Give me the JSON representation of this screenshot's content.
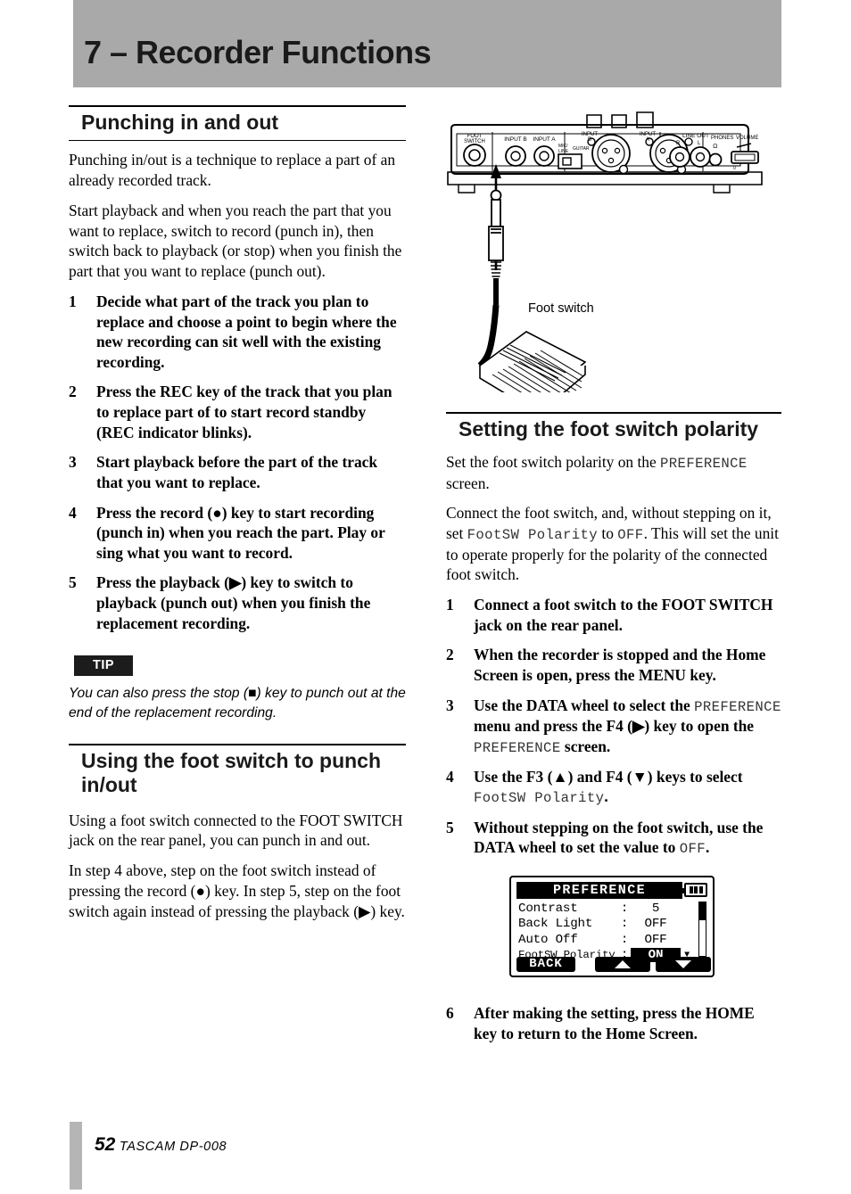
{
  "chapter": {
    "title": "7 – Recorder Functions",
    "bar_color": "#a9a9a9"
  },
  "left_column": {
    "section1": {
      "heading": "Punching in and out",
      "paragraphs": [
        "Punching in/out is a technique to replace a part of an already recorded track.",
        "Start playback and when you reach the part that you want to replace, switch to record (punch in), then switch back to playback (or stop) when you finish the part that you want to replace (punch out)."
      ],
      "steps": [
        {
          "num": "1",
          "text": "Decide what part of the track you plan to replace and choose a point to begin where the new recording can sit well with the existing recording."
        },
        {
          "num": "2",
          "text": "Press the REC key of the track that you plan to replace part of to start record standby (REC indicator blinks)."
        },
        {
          "num": "3",
          "text": "Start playback before the part of the track that you want to replace."
        },
        {
          "num": "4",
          "text": "Press the record (●) key to start recording (punch in) when you reach the part. Play or sing what you want to record."
        },
        {
          "num": "5",
          "text": "Press the playback (▶) key to switch to playback (punch out) when you finish the replacement recording."
        }
      ]
    },
    "tip": {
      "label": "TIP",
      "text": "You can also press the stop (■) key to punch out at the end of the replacement recording."
    },
    "section2": {
      "heading": "Using the foot switch to punch in/out",
      "paragraphs": [
        "Using a foot switch connected to the FOOT SWITCH jack on the rear panel, you can punch in and out.",
        "In step 4 above, step on the foot switch instead of pressing the record (●) key. In step 5, step on the foot switch again instead of pressing the playback (▶) key."
      ]
    }
  },
  "right_column": {
    "figure": {
      "caption": "Foot switch",
      "panel_labels": [
        "FOOT SWITCH",
        "INPUT B",
        "INPUT A",
        "MIC/ LINE GUITAR",
        "INPUT B",
        "INPUT A",
        "LINE OUT",
        "R",
        "L",
        "PHONES",
        "VOLUME"
      ]
    },
    "section3": {
      "heading": "Setting the foot switch polarity",
      "paragraphs": [
        "Set the foot switch polarity on the PREFERENCE screen.",
        "Connect the foot switch, and, without stepping on it, set FootSW Polarity to OFF. This will set the unit to operate properly for the polarity of the connected foot switch."
      ],
      "steps": [
        {
          "num": "1",
          "text": "Connect a foot switch to the FOOT SWITCH jack on the rear panel."
        },
        {
          "num": "2",
          "text": "When the recorder is stopped and the Home Screen is open, press the MENU key."
        },
        {
          "num": "3",
          "text": "Use the DATA wheel to select the PREFERENCE menu and press the F4 (▶) key to open the PREFERENCE screen."
        },
        {
          "num": "4",
          "text": "Use the F3 (▲) and F4 (▼) keys to select FootSW Polarity."
        },
        {
          "num": "5",
          "text": "Without stepping on the foot switch, use the DATA wheel to set the value to OFF."
        },
        {
          "num": "6",
          "text": "After making the setting, press the HOME key to return to the Home Screen."
        }
      ]
    }
  },
  "lcd": {
    "title": "PREFERENCE",
    "rows": [
      {
        "label": "Contrast",
        "colon": ":",
        "value": "5",
        "selected": false
      },
      {
        "label": "Back Light",
        "colon": ":",
        "value": "OFF",
        "selected": false
      },
      {
        "label": "Auto Off",
        "colon": ":",
        "value": "OFF",
        "selected": false
      },
      {
        "label": "FootSW Polarity",
        "colon": ":",
        "value": "ON",
        "selected": true
      }
    ],
    "back_label": "BACK",
    "battery_icon": "battery-full-icon"
  },
  "footer": {
    "page_number": "52",
    "product": "TASCAM DP-008"
  }
}
